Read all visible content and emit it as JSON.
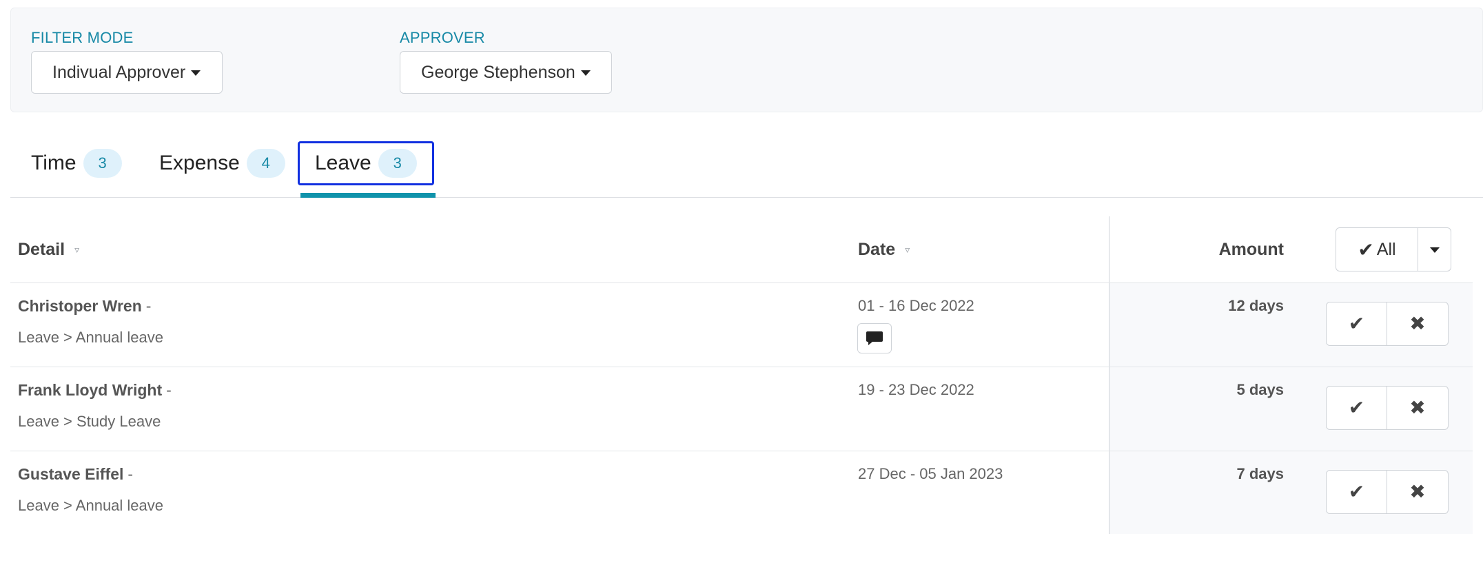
{
  "filters": {
    "mode": {
      "label": "FILTER MODE",
      "value": "Indivual Approver"
    },
    "approver": {
      "label": "APPROVER",
      "value": "George Stephenson"
    }
  },
  "tabs": [
    {
      "label": "Time",
      "count": "3",
      "active": false
    },
    {
      "label": "Expense",
      "count": "4",
      "active": false
    },
    {
      "label": "Leave",
      "count": "3",
      "active": true
    }
  ],
  "table": {
    "headers": {
      "detail": "Detail",
      "date": "Date",
      "amount": "Amount"
    },
    "all_button": {
      "check": "✔",
      "label": "All"
    },
    "rows": [
      {
        "name": "Christoper Wren",
        "category": "Leave > Annual leave",
        "date": "01 - 16 Dec 2022",
        "amount": "12 days",
        "has_comment": true
      },
      {
        "name": "Frank Lloyd Wright",
        "category": "Leave > Study Leave",
        "date": "19 - 23 Dec 2022",
        "amount": "5 days",
        "has_comment": false
      },
      {
        "name": "Gustave Eiffel",
        "category": "Leave > Annual leave",
        "date": "27 Dec - 05 Jan 2023",
        "amount": "7 days",
        "has_comment": false
      }
    ]
  },
  "icons": {
    "approve": "check-icon",
    "reject": "x-icon",
    "comment": "comment-icon",
    "sort": "sort-icon",
    "caret": "caret-down-icon"
  },
  "colors": {
    "accent": "#1789a6",
    "active_tab_border": "#1130e0",
    "tab_underline": "#1093ab",
    "badge_bg": "#dff1fb"
  }
}
